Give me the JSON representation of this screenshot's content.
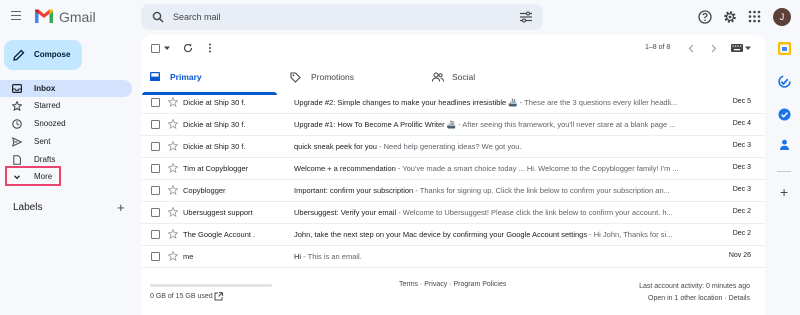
{
  "app": {
    "name": "Gmail",
    "avatar_initial": "J"
  },
  "search": {
    "placeholder": "Search mail"
  },
  "sidebar": {
    "compose_label": "Compose",
    "items": [
      {
        "label": "Inbox",
        "icon": "inbox-icon",
        "active": true
      },
      {
        "label": "Starred",
        "icon": "star-icon"
      },
      {
        "label": "Snoozed",
        "icon": "clock-icon"
      },
      {
        "label": "Sent",
        "icon": "send-icon"
      },
      {
        "label": "Drafts",
        "icon": "draft-icon"
      },
      {
        "label": "More",
        "icon": "chevron-down-icon",
        "highlighted": true
      }
    ],
    "labels_heading": "Labels"
  },
  "toolbar": {
    "page_range": "1–8 of 8"
  },
  "tabs": [
    {
      "label": "Primary",
      "icon": "inbox-icon",
      "active": true
    },
    {
      "label": "Promotions",
      "icon": "tag-icon"
    },
    {
      "label": "Social",
      "icon": "people-icon"
    }
  ],
  "emails": [
    {
      "sender": "Dickie at Ship 30 f.",
      "subject": "Upgrade #2: Simple changes to make your headlines irresistible 🚢",
      "snippet": " - These are the 3 questions every killer headli...",
      "date": "Dec 5"
    },
    {
      "sender": "Dickie at Ship 30 f.",
      "subject": "Upgrade #1: How To Become A Prolific Writer 🚢",
      "snippet": " - After seeing this framework, you'll never stare at a blank page ...",
      "date": "Dec 4"
    },
    {
      "sender": "Dickie at Ship 30 f.",
      "subject": "quick sneak peek for you",
      "snippet": " - Need help generating ideas? We got you.",
      "date": "Dec 3"
    },
    {
      "sender": "Tim at Copyblogger",
      "subject": "Welcome + a recommendation",
      "snippet": " - You've made a smart choice today ... Hi. Welcome to the Copyblogger family! I'm ...",
      "date": "Dec 3"
    },
    {
      "sender": "Copyblogger",
      "subject": "Important: confirm your subscription",
      "snippet": " - Thanks for signing up. Click the link below to confirm your subscription an...",
      "date": "Dec 3"
    },
    {
      "sender": "Ubersuggest support",
      "subject": "Ubersuggest: Verify your email",
      "snippet": " - Welcome to Ubersuggest! Please click the link below to confirm your account. h...",
      "date": "Dec 2"
    },
    {
      "sender": "The Google Account .",
      "subject": "John, take the next step on your Mac device by confirming your Google Account settings",
      "snippet": " - Hi John, Thanks for si...",
      "date": "Dec 2"
    },
    {
      "sender": "me",
      "subject": "Hi",
      "snippet": " - This is an email.",
      "date": "Nov 26"
    }
  ],
  "footer": {
    "storage": "0 GB of 15 GB used",
    "policies": "Terms · Privacy · Program Policies",
    "last_activity": "Last account activity: 0 minutes ago",
    "other_location": "Open in 1 other location · Details"
  },
  "colors": {
    "accent": "#0b57d0",
    "compose_bg": "#c2e7ff",
    "active_nav": "#d3e3fd",
    "highlight_box": "#e8456e"
  }
}
